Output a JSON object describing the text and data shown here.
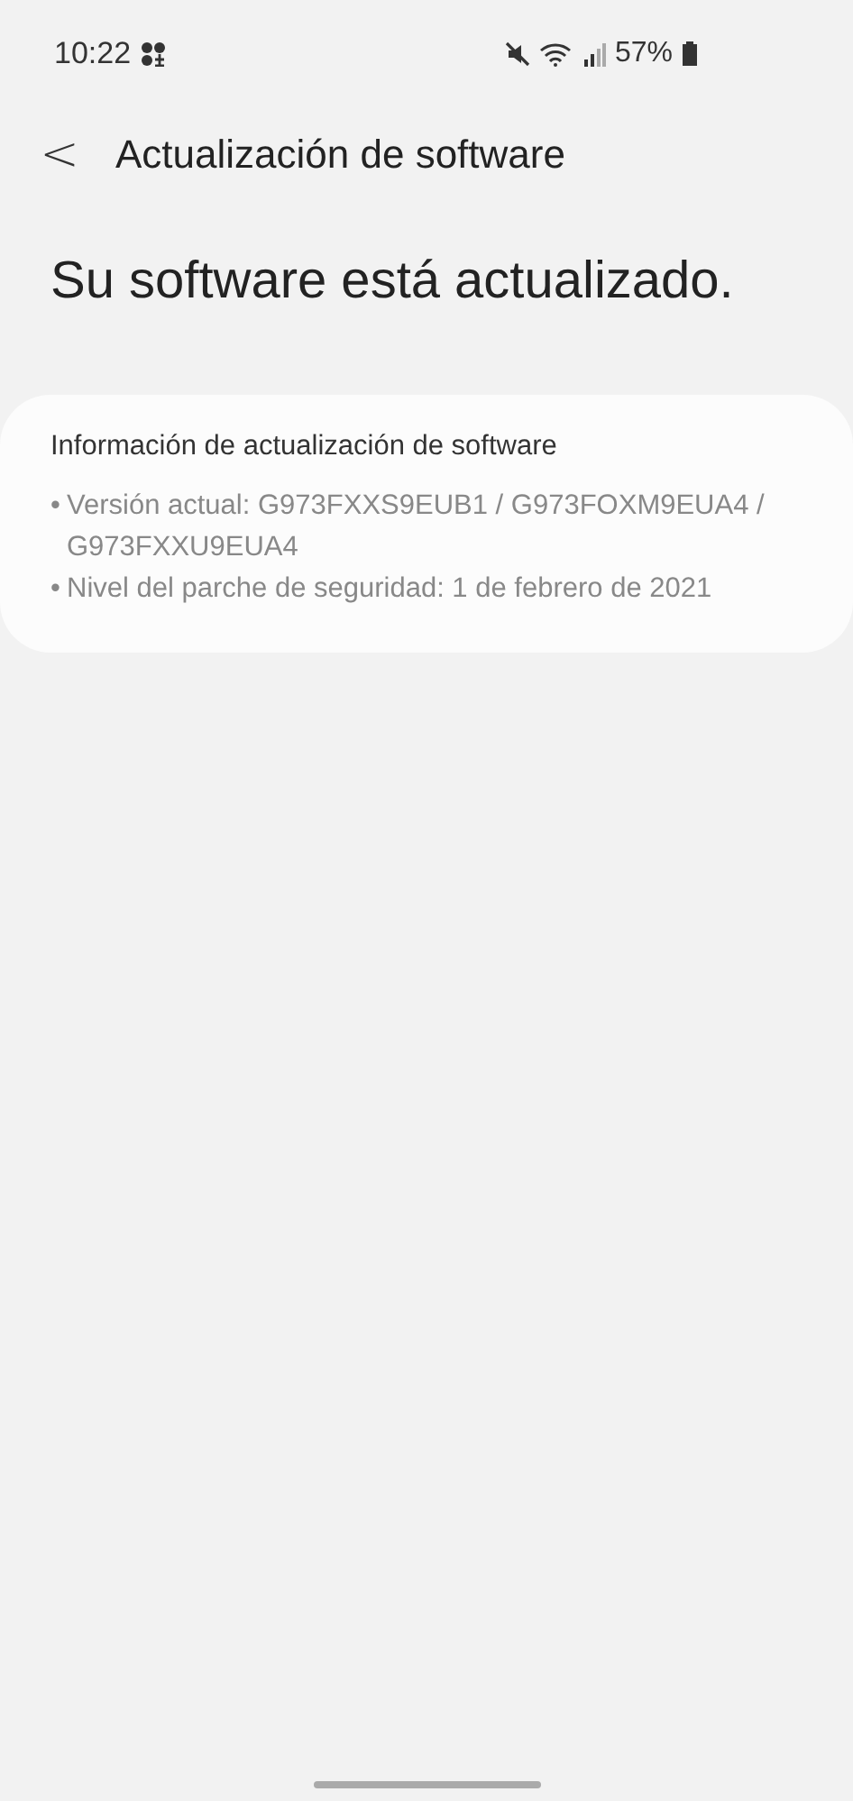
{
  "status_bar": {
    "time": "10:22",
    "battery": "57%"
  },
  "header": {
    "back": "<",
    "title": "Actualización de software"
  },
  "status_message": "Su software está actualizado.",
  "info_card": {
    "title": "Información de actualización de software",
    "items": [
      {
        "bullet": "•",
        "text": "Versión actual: G973FXXS9EUB1 / G973FOXM9EUA4 / G973FXXU9EUA4"
      },
      {
        "bullet": "•",
        "text": "Nivel del parche de seguridad: 1 de febrero de 2021"
      }
    ]
  }
}
